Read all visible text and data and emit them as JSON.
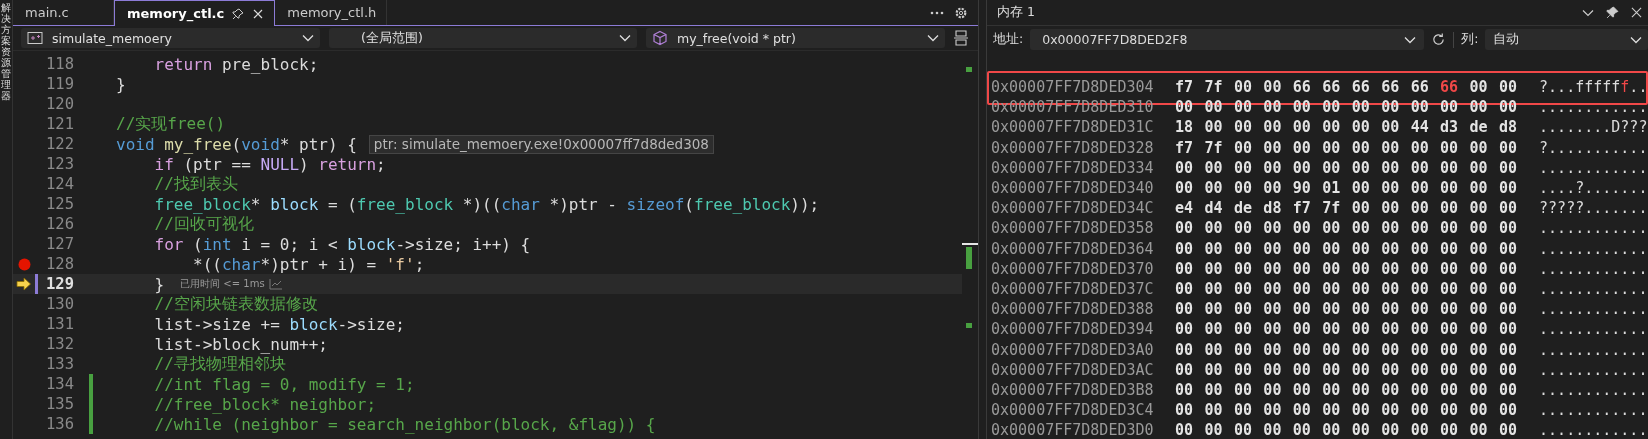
{
  "side_tab": {
    "label": "解决方案资源管理器"
  },
  "tabs": [
    {
      "label": "main.c",
      "selected": false,
      "pinned": false
    },
    {
      "label": "memory_ctl.c",
      "selected": true,
      "pinned": true
    },
    {
      "label": "memory_ctl.h",
      "selected": false,
      "pinned": false
    }
  ],
  "nav_bar": {
    "project": "simulate_memoery",
    "scope": "(全局范围)",
    "member": "my_free(void * ptr)"
  },
  "lines": [
    {
      "number": "118",
      "breakpoint": false,
      "current": false,
      "modified": false,
      "tokens": [
        {
          "kind": "keyword",
          "text": "    return"
        },
        {
          "kind": "plain",
          "text": " pre_block;"
        }
      ]
    },
    {
      "number": "119",
      "breakpoint": false,
      "current": false,
      "modified": false,
      "tokens": [
        {
          "kind": "plain",
          "text": "}"
        }
      ]
    },
    {
      "number": "120",
      "breakpoint": false,
      "current": false,
      "modified": false
    },
    {
      "number": "121",
      "breakpoint": false,
      "current": false,
      "modified": false,
      "tokens": [
        {
          "kind": "comment",
          "text": "//实现free()"
        }
      ]
    },
    {
      "number": "122",
      "breakpoint": false,
      "current": false,
      "modified": false,
      "tokens": [
        {
          "kind": "builtin",
          "text": "void"
        },
        {
          "kind": "function",
          "text": " my_free"
        },
        {
          "kind": "plain",
          "text": "("
        },
        {
          "kind": "builtin",
          "text": "void"
        },
        {
          "kind": "plain",
          "text": "* ptr) {"
        }
      ],
      "datatip": "ptr: simulate_memoery.exe!0x00007ff7d8ded308"
    },
    {
      "number": "123",
      "breakpoint": false,
      "current": false,
      "modified": false,
      "tokens": [
        {
          "kind": "keyword",
          "text": "    if"
        },
        {
          "kind": "plain",
          "text": " (ptr == "
        },
        {
          "kind": "macro",
          "text": "NULL"
        },
        {
          "kind": "plain",
          "text": ") "
        },
        {
          "kind": "keyword",
          "text": "return"
        },
        {
          "kind": "plain",
          "text": ";"
        }
      ]
    },
    {
      "number": "124",
      "breakpoint": false,
      "current": false,
      "modified": false,
      "tokens": [
        {
          "kind": "comment",
          "text": "    //找到表头"
        }
      ]
    },
    {
      "number": "125",
      "breakpoint": false,
      "current": false,
      "modified": false,
      "tokens": [
        {
          "kind": "type",
          "text": "    free_block"
        },
        {
          "kind": "plain",
          "text": "* "
        },
        {
          "kind": "variable",
          "text": "block"
        },
        {
          "kind": "plain",
          "text": " = ("
        },
        {
          "kind": "type",
          "text": "free_block"
        },
        {
          "kind": "plain",
          "text": " *)(("
        },
        {
          "kind": "builtin",
          "text": "char"
        },
        {
          "kind": "plain",
          "text": " *)ptr - "
        },
        {
          "kind": "builtin",
          "text": "sizeof"
        },
        {
          "kind": "plain",
          "text": "("
        },
        {
          "kind": "type",
          "text": "free_block"
        },
        {
          "kind": "plain",
          "text": "));"
        }
      ]
    },
    {
      "number": "126",
      "breakpoint": false,
      "current": false,
      "modified": false,
      "tokens": [
        {
          "kind": "comment",
          "text": "    //回收可视化"
        }
      ]
    },
    {
      "number": "127",
      "breakpoint": false,
      "current": false,
      "modified": false,
      "tokens": [
        {
          "kind": "keyword",
          "text": "    for"
        },
        {
          "kind": "plain",
          "text": " ("
        },
        {
          "kind": "builtin",
          "text": "int"
        },
        {
          "kind": "plain",
          "text": " i = 0; i < "
        },
        {
          "kind": "variable",
          "text": "block"
        },
        {
          "kind": "plain",
          "text": "->size; i++) {"
        }
      ]
    },
    {
      "number": "128",
      "breakpoint": true,
      "current": false,
      "modified": false,
      "tokens": [
        {
          "kind": "plain",
          "text": "        *(("
        },
        {
          "kind": "builtin",
          "text": "char"
        },
        {
          "kind": "plain",
          "text": "*)ptr + i) = "
        },
        {
          "kind": "string",
          "text": "'f'"
        },
        {
          "kind": "plain",
          "text": ";"
        }
      ]
    },
    {
      "number": "129",
      "breakpoint": false,
      "current": true,
      "modified": false,
      "tokens": [
        {
          "kind": "plain",
          "text": "    }"
        }
      ],
      "perf_tip": "已用时间 <= 1ms"
    },
    {
      "number": "130",
      "breakpoint": false,
      "current": false,
      "modified": false,
      "tokens": [
        {
          "kind": "comment",
          "text": "    //空闲块链表数据修改"
        }
      ]
    },
    {
      "number": "131",
      "breakpoint": false,
      "current": false,
      "modified": false,
      "tokens": [
        {
          "kind": "plain",
          "text": "    list->size += "
        },
        {
          "kind": "variable",
          "text": "block"
        },
        {
          "kind": "plain",
          "text": "->size;"
        }
      ]
    },
    {
      "number": "132",
      "breakpoint": false,
      "current": false,
      "modified": false,
      "tokens": [
        {
          "kind": "plain",
          "text": "    list->block_num++;"
        }
      ]
    },
    {
      "number": "133",
      "breakpoint": false,
      "current": false,
      "modified": false,
      "tokens": [
        {
          "kind": "comment",
          "text": "    //寻找物理相邻块"
        }
      ]
    },
    {
      "number": "134",
      "breakpoint": false,
      "current": false,
      "modified": true,
      "tokens": [
        {
          "kind": "comment",
          "text": "    //int flag = 0, modify = 1;"
        }
      ]
    },
    {
      "number": "135",
      "breakpoint": false,
      "current": false,
      "modified": true,
      "tokens": [
        {
          "kind": "comment",
          "text": "    //free_block* neighbor;"
        }
      ]
    },
    {
      "number": "136",
      "breakpoint": false,
      "current": false,
      "modified": true,
      "tokens": [
        {
          "kind": "comment",
          "text": "    //while (neighbor = search_neighbor(block, &flag)) {"
        }
      ]
    }
  ],
  "memory": {
    "title": "内存 1",
    "address_label": "地址:",
    "address": "0x00007FF7D8DED2F8",
    "columns_label": "列:",
    "columns": "自动",
    "rows": [
      {
        "address": "0x00007FF7D8DED304",
        "highlighted": true,
        "bytes": [
          {
            "value": "f7",
            "changed": false
          },
          {
            "value": "7f",
            "changed": false
          },
          {
            "value": "00",
            "changed": false
          },
          {
            "value": "00",
            "changed": false
          },
          {
            "value": "66",
            "changed": false
          },
          {
            "value": "66",
            "changed": false
          },
          {
            "value": "66",
            "changed": false
          },
          {
            "value": "66",
            "changed": false
          },
          {
            "value": "66",
            "changed": false
          },
          {
            "value": "66",
            "changed": true
          },
          {
            "value": "00",
            "changed": false
          },
          {
            "value": "00",
            "changed": false
          }
        ],
        "ascii": [
          {
            "text": "?...fffff",
            "changed": false
          },
          {
            "text": "f",
            "changed": true
          },
          {
            "text": "..",
            "changed": false
          }
        ]
      },
      {
        "address": "0x00007FF7D8DED310",
        "highlighted": false,
        "bytes": [
          {
            "value": "00",
            "changed": false
          },
          {
            "value": "00",
            "changed": false
          },
          {
            "value": "00",
            "changed": false
          },
          {
            "value": "00",
            "changed": false
          },
          {
            "value": "00",
            "changed": false
          },
          {
            "value": "00",
            "changed": false
          },
          {
            "value": "00",
            "changed": false
          },
          {
            "value": "00",
            "changed": false
          },
          {
            "value": "00",
            "changed": false
          },
          {
            "value": "00",
            "changed": false
          },
          {
            "value": "00",
            "changed": false
          },
          {
            "value": "00",
            "changed": false
          }
        ],
        "ascii": [
          {
            "text": "............",
            "changed": false
          }
        ]
      },
      {
        "address": "0x00007FF7D8DED31C",
        "highlighted": false,
        "bytes": [
          {
            "value": "18",
            "changed": false
          },
          {
            "value": "00",
            "changed": false
          },
          {
            "value": "00",
            "changed": false
          },
          {
            "value": "00",
            "changed": false
          },
          {
            "value": "00",
            "changed": false
          },
          {
            "value": "00",
            "changed": false
          },
          {
            "value": "00",
            "changed": false
          },
          {
            "value": "00",
            "changed": false
          },
          {
            "value": "44",
            "changed": false
          },
          {
            "value": "d3",
            "changed": false
          },
          {
            "value": "de",
            "changed": false
          },
          {
            "value": "d8",
            "changed": false
          }
        ],
        "ascii": [
          {
            "text": "........D???",
            "changed": false
          }
        ]
      },
      {
        "address": "0x00007FF7D8DED328",
        "highlighted": false,
        "bytes": [
          {
            "value": "f7",
            "changed": false
          },
          {
            "value": "7f",
            "changed": false
          },
          {
            "value": "00",
            "changed": false
          },
          {
            "value": "00",
            "changed": false
          },
          {
            "value": "00",
            "changed": false
          },
          {
            "value": "00",
            "changed": false
          },
          {
            "value": "00",
            "changed": false
          },
          {
            "value": "00",
            "changed": false
          },
          {
            "value": "00",
            "changed": false
          },
          {
            "value": "00",
            "changed": false
          },
          {
            "value": "00",
            "changed": false
          },
          {
            "value": "00",
            "changed": false
          }
        ],
        "ascii": [
          {
            "text": "?...........",
            "changed": false
          }
        ]
      },
      {
        "address": "0x00007FF7D8DED334",
        "highlighted": false,
        "bytes": [
          {
            "value": "00",
            "changed": false
          },
          {
            "value": "00",
            "changed": false
          },
          {
            "value": "00",
            "changed": false
          },
          {
            "value": "00",
            "changed": false
          },
          {
            "value": "00",
            "changed": false
          },
          {
            "value": "00",
            "changed": false
          },
          {
            "value": "00",
            "changed": false
          },
          {
            "value": "00",
            "changed": false
          },
          {
            "value": "00",
            "changed": false
          },
          {
            "value": "00",
            "changed": false
          },
          {
            "value": "00",
            "changed": false
          },
          {
            "value": "00",
            "changed": false
          }
        ],
        "ascii": [
          {
            "text": "............",
            "changed": false
          }
        ]
      },
      {
        "address": "0x00007FF7D8DED340",
        "highlighted": false,
        "bytes": [
          {
            "value": "00",
            "changed": false
          },
          {
            "value": "00",
            "changed": false
          },
          {
            "value": "00",
            "changed": false
          },
          {
            "value": "00",
            "changed": false
          },
          {
            "value": "90",
            "changed": false
          },
          {
            "value": "01",
            "changed": false
          },
          {
            "value": "00",
            "changed": false
          },
          {
            "value": "00",
            "changed": false
          },
          {
            "value": "00",
            "changed": false
          },
          {
            "value": "00",
            "changed": false
          },
          {
            "value": "00",
            "changed": false
          },
          {
            "value": "00",
            "changed": false
          }
        ],
        "ascii": [
          {
            "text": "....?.......",
            "changed": false
          }
        ]
      },
      {
        "address": "0x00007FF7D8DED34C",
        "highlighted": false,
        "bytes": [
          {
            "value": "e4",
            "changed": false
          },
          {
            "value": "d4",
            "changed": false
          },
          {
            "value": "de",
            "changed": false
          },
          {
            "value": "d8",
            "changed": false
          },
          {
            "value": "f7",
            "changed": false
          },
          {
            "value": "7f",
            "changed": false
          },
          {
            "value": "00",
            "changed": false
          },
          {
            "value": "00",
            "changed": false
          },
          {
            "value": "00",
            "changed": false
          },
          {
            "value": "00",
            "changed": false
          },
          {
            "value": "00",
            "changed": false
          },
          {
            "value": "00",
            "changed": false
          }
        ],
        "ascii": [
          {
            "text": "?????.......",
            "changed": false
          }
        ]
      },
      {
        "address": "0x00007FF7D8DED358",
        "highlighted": false,
        "bytes": [
          {
            "value": "00",
            "changed": false
          },
          {
            "value": "00",
            "changed": false
          },
          {
            "value": "00",
            "changed": false
          },
          {
            "value": "00",
            "changed": false
          },
          {
            "value": "00",
            "changed": false
          },
          {
            "value": "00",
            "changed": false
          },
          {
            "value": "00",
            "changed": false
          },
          {
            "value": "00",
            "changed": false
          },
          {
            "value": "00",
            "changed": false
          },
          {
            "value": "00",
            "changed": false
          },
          {
            "value": "00",
            "changed": false
          },
          {
            "value": "00",
            "changed": false
          }
        ],
        "ascii": [
          {
            "text": "............",
            "changed": false
          }
        ]
      },
      {
        "address": "0x00007FF7D8DED364",
        "highlighted": false,
        "bytes": [
          {
            "value": "00",
            "changed": false
          },
          {
            "value": "00",
            "changed": false
          },
          {
            "value": "00",
            "changed": false
          },
          {
            "value": "00",
            "changed": false
          },
          {
            "value": "00",
            "changed": false
          },
          {
            "value": "00",
            "changed": false
          },
          {
            "value": "00",
            "changed": false
          },
          {
            "value": "00",
            "changed": false
          },
          {
            "value": "00",
            "changed": false
          },
          {
            "value": "00",
            "changed": false
          },
          {
            "value": "00",
            "changed": false
          },
          {
            "value": "00",
            "changed": false
          }
        ],
        "ascii": [
          {
            "text": "............",
            "changed": false
          }
        ]
      },
      {
        "address": "0x00007FF7D8DED370",
        "highlighted": false,
        "bytes": [
          {
            "value": "00",
            "changed": false
          },
          {
            "value": "00",
            "changed": false
          },
          {
            "value": "00",
            "changed": false
          },
          {
            "value": "00",
            "changed": false
          },
          {
            "value": "00",
            "changed": false
          },
          {
            "value": "00",
            "changed": false
          },
          {
            "value": "00",
            "changed": false
          },
          {
            "value": "00",
            "changed": false
          },
          {
            "value": "00",
            "changed": false
          },
          {
            "value": "00",
            "changed": false
          },
          {
            "value": "00",
            "changed": false
          },
          {
            "value": "00",
            "changed": false
          }
        ],
        "ascii": [
          {
            "text": "............",
            "changed": false
          }
        ]
      },
      {
        "address": "0x00007FF7D8DED37C",
        "highlighted": false,
        "bytes": [
          {
            "value": "00",
            "changed": false
          },
          {
            "value": "00",
            "changed": false
          },
          {
            "value": "00",
            "changed": false
          },
          {
            "value": "00",
            "changed": false
          },
          {
            "value": "00",
            "changed": false
          },
          {
            "value": "00",
            "changed": false
          },
          {
            "value": "00",
            "changed": false
          },
          {
            "value": "00",
            "changed": false
          },
          {
            "value": "00",
            "changed": false
          },
          {
            "value": "00",
            "changed": false
          },
          {
            "value": "00",
            "changed": false
          },
          {
            "value": "00",
            "changed": false
          }
        ],
        "ascii": [
          {
            "text": "............",
            "changed": false
          }
        ]
      },
      {
        "address": "0x00007FF7D8DED388",
        "highlighted": false,
        "bytes": [
          {
            "value": "00",
            "changed": false
          },
          {
            "value": "00",
            "changed": false
          },
          {
            "value": "00",
            "changed": false
          },
          {
            "value": "00",
            "changed": false
          },
          {
            "value": "00",
            "changed": false
          },
          {
            "value": "00",
            "changed": false
          },
          {
            "value": "00",
            "changed": false
          },
          {
            "value": "00",
            "changed": false
          },
          {
            "value": "00",
            "changed": false
          },
          {
            "value": "00",
            "changed": false
          },
          {
            "value": "00",
            "changed": false
          },
          {
            "value": "00",
            "changed": false
          }
        ],
        "ascii": [
          {
            "text": "............",
            "changed": false
          }
        ]
      },
      {
        "address": "0x00007FF7D8DED394",
        "highlighted": false,
        "bytes": [
          {
            "value": "00",
            "changed": false
          },
          {
            "value": "00",
            "changed": false
          },
          {
            "value": "00",
            "changed": false
          },
          {
            "value": "00",
            "changed": false
          },
          {
            "value": "00",
            "changed": false
          },
          {
            "value": "00",
            "changed": false
          },
          {
            "value": "00",
            "changed": false
          },
          {
            "value": "00",
            "changed": false
          },
          {
            "value": "00",
            "changed": false
          },
          {
            "value": "00",
            "changed": false
          },
          {
            "value": "00",
            "changed": false
          },
          {
            "value": "00",
            "changed": false
          }
        ],
        "ascii": [
          {
            "text": "............",
            "changed": false
          }
        ]
      },
      {
        "address": "0x00007FF7D8DED3A0",
        "highlighted": false,
        "bytes": [
          {
            "value": "00",
            "changed": false
          },
          {
            "value": "00",
            "changed": false
          },
          {
            "value": "00",
            "changed": false
          },
          {
            "value": "00",
            "changed": false
          },
          {
            "value": "00",
            "changed": false
          },
          {
            "value": "00",
            "changed": false
          },
          {
            "value": "00",
            "changed": false
          },
          {
            "value": "00",
            "changed": false
          },
          {
            "value": "00",
            "changed": false
          },
          {
            "value": "00",
            "changed": false
          },
          {
            "value": "00",
            "changed": false
          },
          {
            "value": "00",
            "changed": false
          }
        ],
        "ascii": [
          {
            "text": "............",
            "changed": false
          }
        ]
      },
      {
        "address": "0x00007FF7D8DED3AC",
        "highlighted": false,
        "bytes": [
          {
            "value": "00",
            "changed": false
          },
          {
            "value": "00",
            "changed": false
          },
          {
            "value": "00",
            "changed": false
          },
          {
            "value": "00",
            "changed": false
          },
          {
            "value": "00",
            "changed": false
          },
          {
            "value": "00",
            "changed": false
          },
          {
            "value": "00",
            "changed": false
          },
          {
            "value": "00",
            "changed": false
          },
          {
            "value": "00",
            "changed": false
          },
          {
            "value": "00",
            "changed": false
          },
          {
            "value": "00",
            "changed": false
          },
          {
            "value": "00",
            "changed": false
          }
        ],
        "ascii": [
          {
            "text": "............",
            "changed": false
          }
        ]
      },
      {
        "address": "0x00007FF7D8DED3B8",
        "highlighted": false,
        "bytes": [
          {
            "value": "00",
            "changed": false
          },
          {
            "value": "00",
            "changed": false
          },
          {
            "value": "00",
            "changed": false
          },
          {
            "value": "00",
            "changed": false
          },
          {
            "value": "00",
            "changed": false
          },
          {
            "value": "00",
            "changed": false
          },
          {
            "value": "00",
            "changed": false
          },
          {
            "value": "00",
            "changed": false
          },
          {
            "value": "00",
            "changed": false
          },
          {
            "value": "00",
            "changed": false
          },
          {
            "value": "00",
            "changed": false
          },
          {
            "value": "00",
            "changed": false
          }
        ],
        "ascii": [
          {
            "text": "............",
            "changed": false
          }
        ]
      },
      {
        "address": "0x00007FF7D8DED3C4",
        "highlighted": false,
        "bytes": [
          {
            "value": "00",
            "changed": false
          },
          {
            "value": "00",
            "changed": false
          },
          {
            "value": "00",
            "changed": false
          },
          {
            "value": "00",
            "changed": false
          },
          {
            "value": "00",
            "changed": false
          },
          {
            "value": "00",
            "changed": false
          },
          {
            "value": "00",
            "changed": false
          },
          {
            "value": "00",
            "changed": false
          },
          {
            "value": "00",
            "changed": false
          },
          {
            "value": "00",
            "changed": false
          },
          {
            "value": "00",
            "changed": false
          },
          {
            "value": "00",
            "changed": false
          }
        ],
        "ascii": [
          {
            "text": "............",
            "changed": false
          }
        ]
      },
      {
        "address": "0x00007FF7D8DED3D0",
        "highlighted": false,
        "bytes": [
          {
            "value": "00",
            "changed": false
          },
          {
            "value": "00",
            "changed": false
          },
          {
            "value": "00",
            "changed": false
          },
          {
            "value": "00",
            "changed": false
          },
          {
            "value": "00",
            "changed": false
          },
          {
            "value": "00",
            "changed": false
          },
          {
            "value": "00",
            "changed": false
          },
          {
            "value": "00",
            "changed": false
          },
          {
            "value": "00",
            "changed": false
          },
          {
            "value": "00",
            "changed": false
          },
          {
            "value": "00",
            "changed": false
          },
          {
            "value": "00",
            "changed": false
          }
        ],
        "ascii": [
          {
            "text": "............",
            "changed": false
          }
        ]
      }
    ]
  }
}
